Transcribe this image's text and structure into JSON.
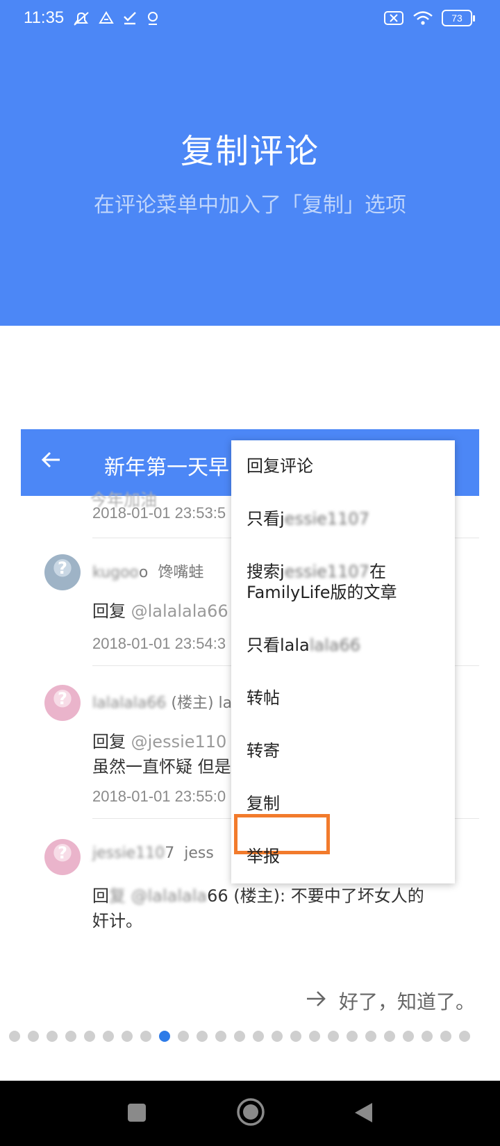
{
  "status_bar": {
    "time": "11:35",
    "battery": "73",
    "icons_left": [
      "silent-icon",
      "drive-icon",
      "check-icon",
      "location-icon"
    ],
    "icons_right": [
      "sim-x-icon",
      "wifi-icon",
      "battery-icon"
    ]
  },
  "hero": {
    "title": "复制评论",
    "subtitle": "在评论菜单中加入了「复制」选项",
    "background": "#4c87f6"
  },
  "preview": {
    "header_title": "新年第一天早",
    "partial_text": "今年加油",
    "comments": [
      {
        "time": "2018-01-01 23:53:5"
      },
      {
        "name": "kugoo",
        "name_tail": "o",
        "nickname": "馋嘴蛙",
        "reply_prefix": "回复",
        "reply_to": "@lalalala66",
        "time": "2018-01-01 23:54:3"
      },
      {
        "name": "lalalala66",
        "role": "(楼主)",
        "nickname": "lal",
        "reply_prefix": "回复",
        "reply_to": "@jessie110",
        "line2": "虽然一直怀疑 但是",
        "time": "2018-01-01 23:55:0"
      },
      {
        "name": "jessie110",
        "name_tail": "7",
        "nickname": "jess",
        "reply_prefix": "回",
        "reply_blur": "复 @lalalala",
        "reply_tail": "66 (楼主): 不要中了坏女人的",
        "line2": "奸计。"
      }
    ],
    "menu": {
      "reply": "回复评论",
      "only_user_prefix": "只看j",
      "only_user_blur": "essie1107",
      "search_prefix": "搜索j",
      "search_blur": "essie1107",
      "search_mid": "在",
      "search_line2": "FamilyLife版的文章",
      "only_user2_prefix": "只看lala",
      "only_user2_blur": "lala66",
      "forward": "转帖",
      "mail": "转寄",
      "copy": "复制",
      "report": "举报",
      "highlight_color": "#f27b2c"
    }
  },
  "footer": {
    "got_it": "好了，知道了。",
    "page_total": 25,
    "page_current": 9,
    "active_dot_color": "#2d7be8"
  }
}
